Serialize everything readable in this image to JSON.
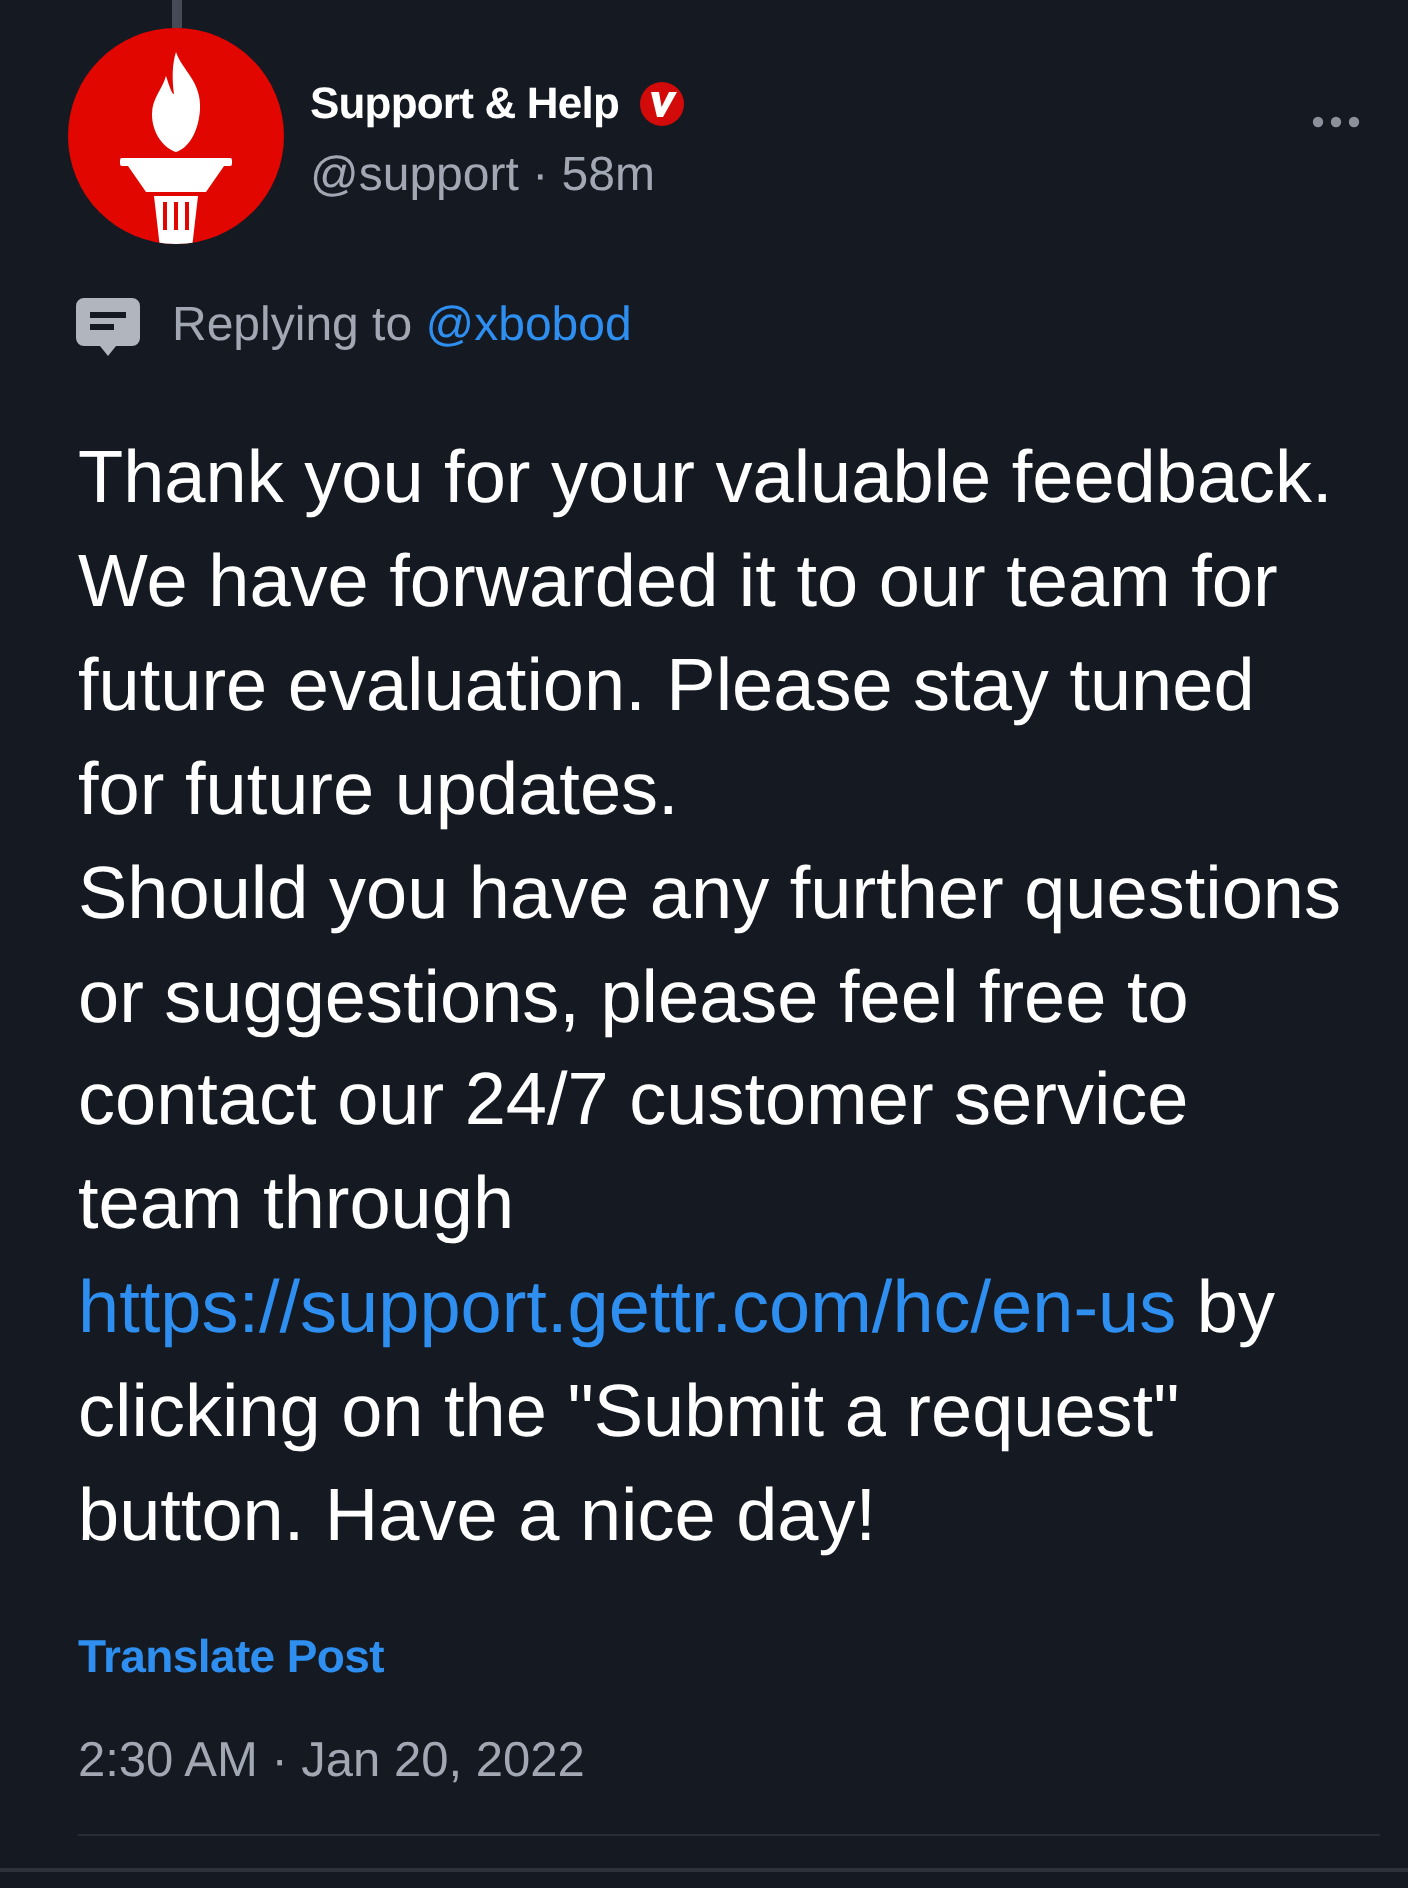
{
  "post": {
    "author": {
      "name": "Support & Help",
      "verified": true,
      "handle_time": "@support · 58m"
    },
    "reply_context": {
      "label": "Replying to",
      "mention": "@xbobod"
    },
    "body": [
      {
        "segments": [
          {
            "kind": "text",
            "text": "Thank you for your valuable feedback. We have forwarded it to our team for future evaluation. Please stay tuned for future updates."
          }
        ]
      },
      {
        "segments": [
          {
            "kind": "text",
            "text": "Should you have any further questions or suggestions, please feel free to contact our 24/7 customer service team through "
          },
          {
            "kind": "link",
            "text": "https://support.gettr.com/hc/en-us"
          },
          {
            "kind": "text",
            "text": " by clicking on the \"Submit a request\" button. Have a nice day!"
          }
        ]
      }
    ],
    "translate_label": "Translate Post",
    "timestamp": "2:30 AM · Jan 20, 2022"
  }
}
